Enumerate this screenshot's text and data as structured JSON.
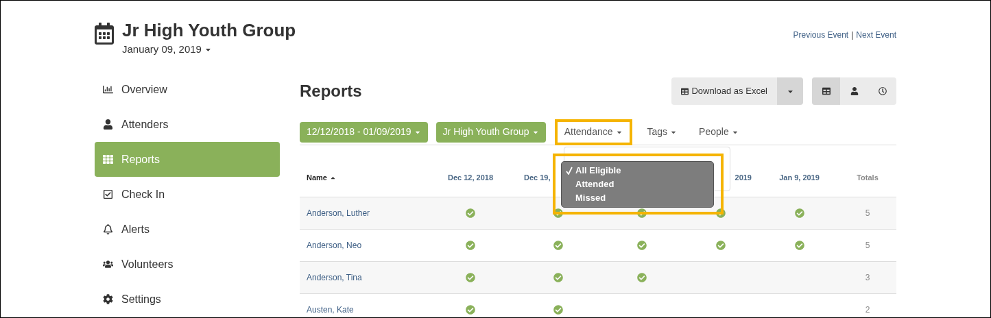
{
  "header": {
    "title": "Jr High Youth Group",
    "date": "January 09, 2019",
    "links": [
      "Previous Event",
      "Next Event"
    ],
    "link_separator": "|"
  },
  "sidebar": {
    "items": [
      {
        "label": "Overview",
        "selected": false
      },
      {
        "label": "Attenders",
        "selected": false
      },
      {
        "label": "Reports",
        "selected": true
      },
      {
        "label": "Check In",
        "selected": false
      },
      {
        "label": "Alerts",
        "selected": false
      },
      {
        "label": "Volunteers",
        "selected": false
      },
      {
        "label": "Settings",
        "selected": false
      }
    ]
  },
  "page_title": "Reports",
  "download_button": {
    "label": "Download as Excel"
  },
  "view_buttons": [
    {
      "selected": true
    },
    {
      "selected": false
    },
    {
      "selected": false
    }
  ],
  "filters": [
    {
      "label": "12/12/2018 - 01/09/2019",
      "kind": "green",
      "annotated": false
    },
    {
      "label": "Jr High Youth Group",
      "kind": "green",
      "annotated": false
    },
    {
      "label": "Attendance",
      "kind": "plain",
      "annotated": true
    },
    {
      "label": "Tags",
      "kind": "plain",
      "annotated": false
    },
    {
      "label": "People",
      "kind": "plain",
      "annotated": false
    }
  ],
  "attendance_menu": {
    "annotated": true,
    "options": [
      {
        "label": "All Eligible",
        "selected": true
      },
      {
        "label": "Attended",
        "selected": false
      },
      {
        "label": "Missed",
        "selected": false
      }
    ]
  },
  "table": {
    "columns": [
      {
        "label": "Name",
        "kind": "name"
      },
      {
        "label": "Dec 12, 2018",
        "kind": "date"
      },
      {
        "label": "Dec 19,",
        "kind": "date_cut_end"
      },
      {
        "kind": "date"
      },
      {
        "label": "2019",
        "kind": "date_cut_start"
      },
      {
        "label": "Jan 9, 2019",
        "kind": "date"
      },
      {
        "label": "Totals",
        "kind": "total"
      }
    ],
    "rows": [
      {
        "name": "Anderson, Luther",
        "attended": [
          true,
          true,
          true,
          true,
          true
        ],
        "total": "5"
      },
      {
        "name": "Anderson, Neo",
        "attended": [
          true,
          true,
          true,
          true,
          true
        ],
        "total": "5"
      },
      {
        "name": "Anderson, Tina",
        "attended": [
          true,
          true,
          true,
          false,
          false
        ],
        "total": "3"
      },
      {
        "name": "Austen, Kate",
        "attended": [
          true,
          true,
          false,
          false,
          false
        ],
        "total": "2"
      }
    ]
  }
}
